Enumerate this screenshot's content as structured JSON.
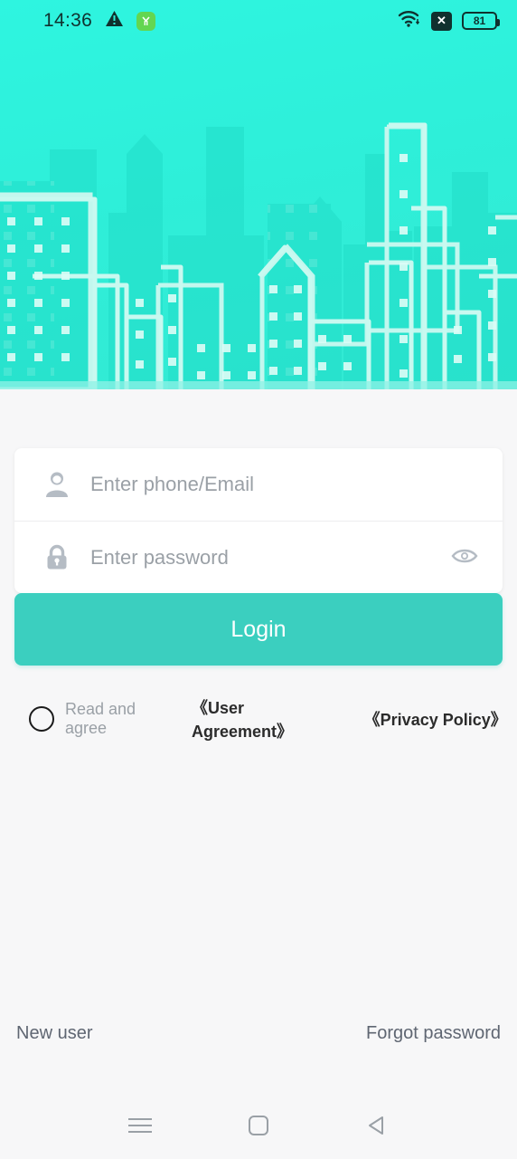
{
  "status_bar": {
    "time": "14:36",
    "warning_icon": "warning-triangle-icon",
    "app_badge_icon": "green-app-badge-icon",
    "wifi_icon": "wifi-icon",
    "x_badge_icon": "x-badge-icon",
    "battery_level": "81"
  },
  "hero": {
    "illustration": "city-skyline-illustration",
    "background_color": "#2eefd9"
  },
  "form": {
    "username": {
      "value": "",
      "placeholder": "Enter phone/Email",
      "icon": "person-icon"
    },
    "password": {
      "value": "",
      "placeholder": "Enter password",
      "icon": "lock-icon",
      "toggle_icon": "eye-icon"
    },
    "login_label": "Login",
    "login_color": "#3bcfbf"
  },
  "agreement": {
    "checked": false,
    "prefix": "Read and agree",
    "user_agreement": "《User Agreement》",
    "privacy_policy": "《Privacy Policy》"
  },
  "footer": {
    "new_user": "New user",
    "forgot_password": "Forgot password"
  },
  "navbar": {
    "recents_icon": "menu-icon",
    "home_icon": "home-square-icon",
    "back_icon": "back-triangle-icon"
  }
}
